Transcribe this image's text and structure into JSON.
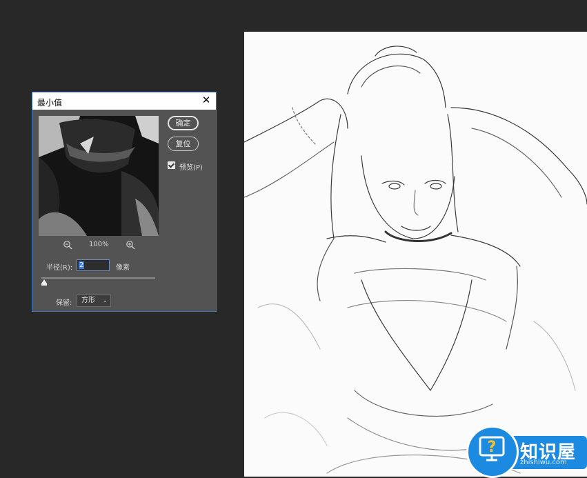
{
  "dialog": {
    "title": "最小值",
    "close_glyph": "✕",
    "ok_label": "确定",
    "reset_label": "复位",
    "preview_label": "预览(P)",
    "preview_checked": true,
    "zoom_level": "100%",
    "radius_label": "半径(R):",
    "radius_value": "2",
    "radius_unit": "像素",
    "slider_level_percent": 1,
    "preserve_label": "保留:",
    "preserve_value": "方形"
  },
  "watermark": {
    "logo_text": "知识屋",
    "logo_url": "zhishiwu.com",
    "brand_color": "#1c8ae0"
  },
  "icons": {
    "zoom_out": "zoom-out-icon",
    "zoom_in": "zoom-in-icon",
    "close": "close-icon",
    "dropdown": "chevron-down-icon"
  }
}
